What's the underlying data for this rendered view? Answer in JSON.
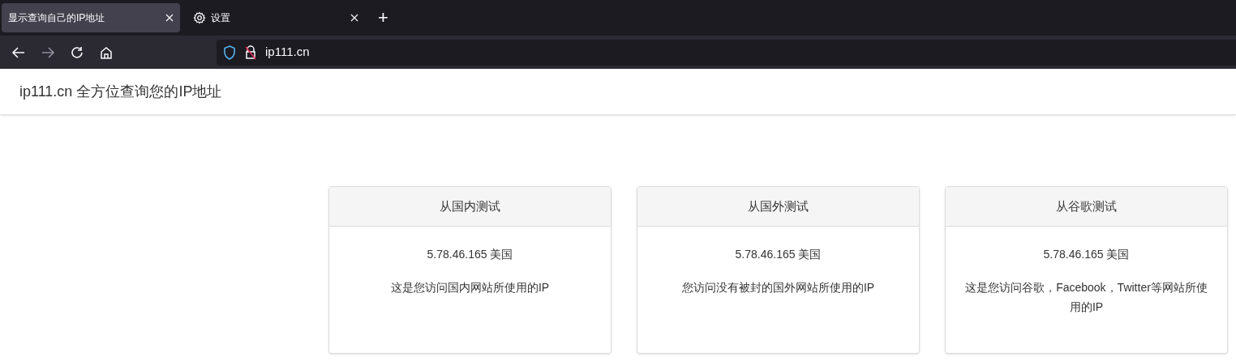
{
  "tabs": [
    {
      "title": "显示查询自己的IP地址",
      "selected": true,
      "kind": "page"
    },
    {
      "title": "设置",
      "selected": false,
      "kind": "settings"
    }
  ],
  "new_tab": "+",
  "toolbar": {
    "forward_disabled": true
  },
  "address_bar": {
    "url": "ip111.cn"
  },
  "site_title": "ip111.cn 全方位查询您的IP地址",
  "cards": [
    {
      "heading": "从国内测试",
      "ip": "5.78.46.165 美国",
      "description": "这是您访问国内网站所使用的IP"
    },
    {
      "heading": "从国外测试",
      "ip": "5.78.46.165 美国",
      "description": "您访问没有被封的国外网站所使用的IP"
    },
    {
      "heading": "从谷歌测试",
      "ip": "5.78.46.165 美国",
      "description": "这是您访问谷歌，Facebook，Twitter等网站所使用的IP"
    }
  ]
}
